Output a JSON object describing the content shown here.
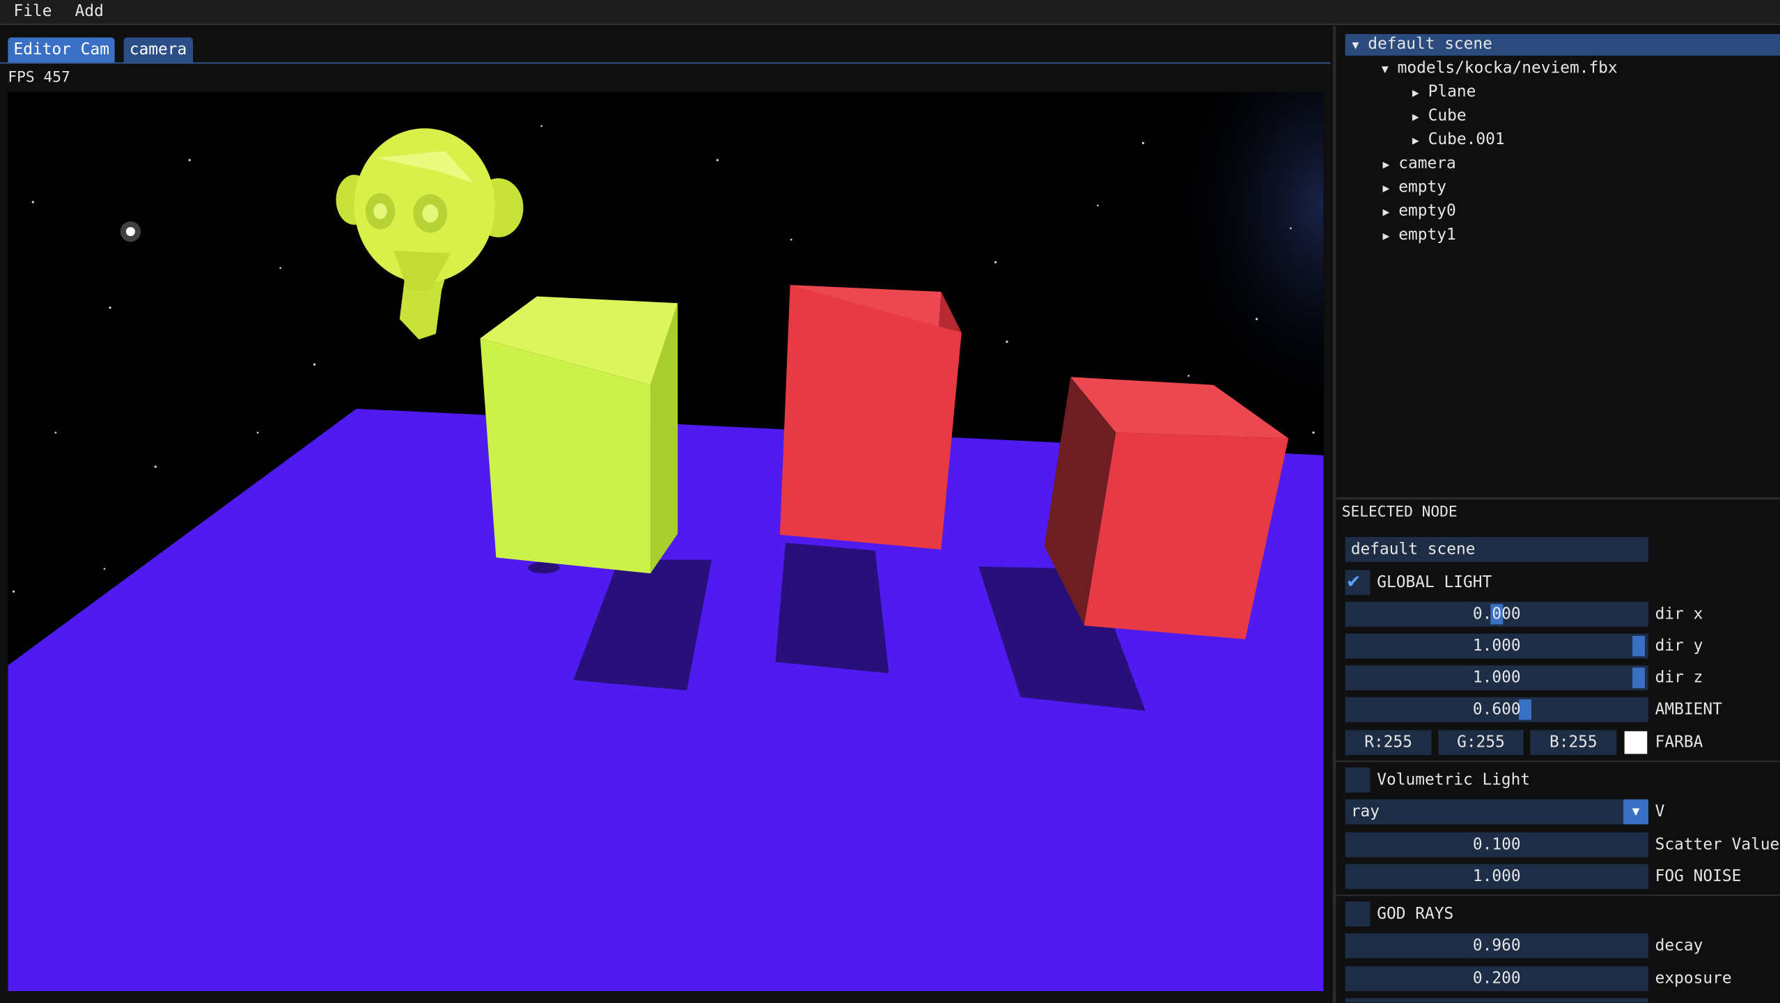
{
  "menu": {
    "file": "File",
    "add": "Add"
  },
  "tabs": [
    {
      "label": "Editor Cam",
      "active": true
    },
    {
      "label": "camera",
      "active": false
    }
  ],
  "fps_text": "FPS 457",
  "scene_tree": {
    "root": "default scene",
    "model": "models/kocka/neviem.fbx",
    "model_children": [
      "Plane",
      "Cube",
      "Cube.001"
    ],
    "other": [
      "camera",
      "empty",
      "empty0",
      "empty1"
    ]
  },
  "selected_node": {
    "header": "SELECTED NODE",
    "name": "default scene",
    "global_light": {
      "label": "GLOBAL LIGHT",
      "checked": true
    },
    "dir_x": {
      "value": "0.000",
      "label": "dir x",
      "fraction": 0.5
    },
    "dir_y": {
      "value": "1.000",
      "label": "dir y",
      "fraction": 1.0
    },
    "dir_z": {
      "value": "1.000",
      "label": "dir z",
      "fraction": 1.0
    },
    "ambient": {
      "value": "0.600",
      "label": "AMBIENT",
      "fraction": 0.6
    },
    "color": {
      "r": "R:255",
      "g": "G:255",
      "b": "B:255",
      "label": "FARBA",
      "hex": "#ffffff"
    },
    "volumetric": {
      "label": "Volumetric Light",
      "checked": false
    },
    "mode": {
      "value": "ray",
      "label": "V"
    },
    "scatter": {
      "value": "0.100",
      "label": "Scatter Value"
    },
    "fog_noise": {
      "value": "1.000",
      "label": "FOG NOISE"
    },
    "god_rays": {
      "label": "GOD RAYS",
      "checked": false
    },
    "decay": {
      "value": "0.960",
      "label": "decay"
    },
    "exposure": {
      "value": "0.200",
      "label": "exposure"
    }
  },
  "icons": {
    "tree_open": "▼",
    "tree_closed": "▶",
    "check": "✔",
    "combo": "▼"
  },
  "colors": {
    "accent": "#3a70c4",
    "floor": "#4f1bf0",
    "cube_yellow": "#ccf24a",
    "cube_red": "#e83a45",
    "monkey": "#d9f04a"
  }
}
